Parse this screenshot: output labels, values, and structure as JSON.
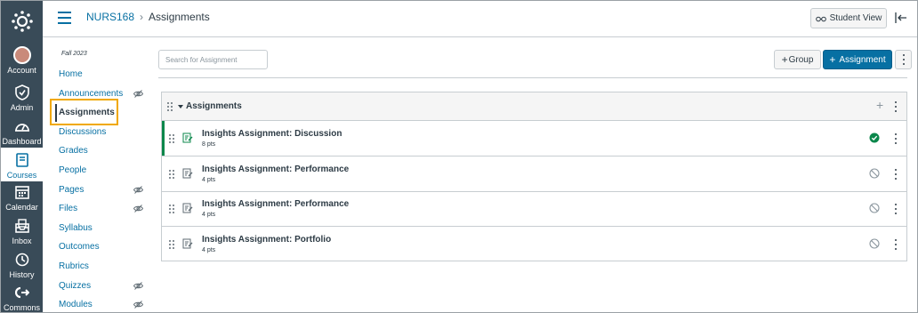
{
  "global_nav": {
    "items": [
      {
        "label": "Account",
        "icon": "avatar"
      },
      {
        "label": "Admin",
        "icon": "shield-icon"
      },
      {
        "label": "Dashboard",
        "icon": "dashboard-icon"
      },
      {
        "label": "Courses",
        "icon": "courses-icon",
        "active": true
      },
      {
        "label": "Calendar",
        "icon": "calendar-icon"
      },
      {
        "label": "Inbox",
        "icon": "inbox-icon"
      },
      {
        "label": "History",
        "icon": "clock-icon"
      },
      {
        "label": "Commons",
        "icon": "commons-icon"
      }
    ]
  },
  "header": {
    "course": "NURS168",
    "separator": "›",
    "page": "Assignments",
    "student_view_label": "Student View"
  },
  "course_nav": {
    "term": "Fall 2023",
    "items": [
      {
        "label": "Home",
        "hidden": false
      },
      {
        "label": "Announcements",
        "hidden": true
      },
      {
        "label": "Assignments",
        "hidden": false,
        "active": true
      },
      {
        "label": "Discussions",
        "hidden": false
      },
      {
        "label": "Grades",
        "hidden": false
      },
      {
        "label": "People",
        "hidden": false
      },
      {
        "label": "Pages",
        "hidden": true
      },
      {
        "label": "Files",
        "hidden": true
      },
      {
        "label": "Syllabus",
        "hidden": false
      },
      {
        "label": "Outcomes",
        "hidden": false
      },
      {
        "label": "Rubrics",
        "hidden": false
      },
      {
        "label": "Quizzes",
        "hidden": true
      },
      {
        "label": "Modules",
        "hidden": true
      }
    ]
  },
  "toolbar": {
    "search_placeholder": "Search for Assignment",
    "group_label": "Group",
    "assignment_label": "Assignment"
  },
  "group": {
    "title": "Assignments",
    "assignments": [
      {
        "title": "Insights Assignment: Discussion",
        "points": "8 pts",
        "published": true
      },
      {
        "title": "Insights Assignment: Performance",
        "points": "4 pts",
        "published": false
      },
      {
        "title": "Insights Assignment: Performance",
        "points": "4 pts",
        "published": false
      },
      {
        "title": "Insights Assignment: Portfolio",
        "points": "4 pts",
        "published": false
      }
    ]
  },
  "colors": {
    "nav_bg": "#394b58",
    "link": "#0770a3",
    "published": "#0b874b",
    "highlight": "#f0a800"
  }
}
